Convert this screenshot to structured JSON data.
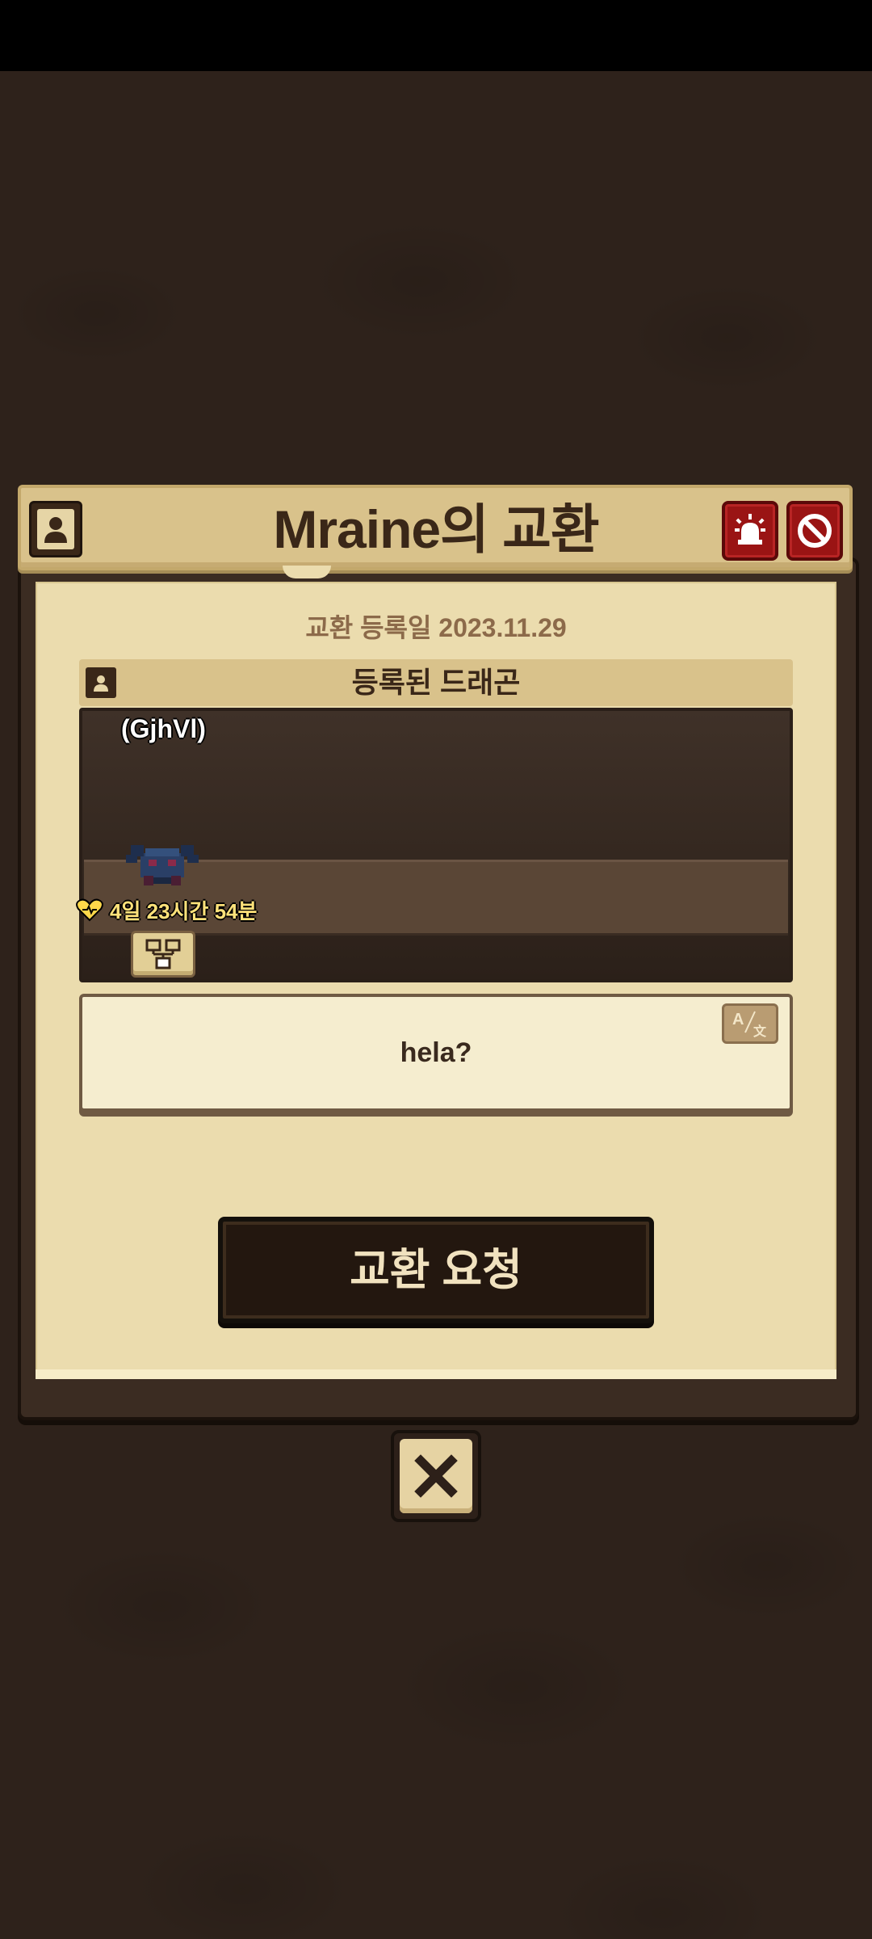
{
  "header": {
    "title": "Mraine의 교환",
    "profile_icon": "profile-icon",
    "report_icon": "alarm-siren-icon",
    "block_icon": "block-icon"
  },
  "trade": {
    "registered_date_label": "교환 등록일 2023.11.29",
    "section_title": "등록된 드래곤",
    "dragon": {
      "name": "(GjhVl)",
      "timer": "4일 23시간 54분",
      "timer_icon": "heart-icon",
      "breed_icon": "family-tree-icon"
    },
    "message": "hela?",
    "translate_icon": "translate-icon",
    "request_button_label": "교환 요청"
  },
  "close_icon": "close-x-icon",
  "colors": {
    "background": "#2e221b",
    "paper": "#ebdcae",
    "header": "#d9c28b",
    "danger": "#9a1414",
    "timer_text": "#ffe27a"
  }
}
